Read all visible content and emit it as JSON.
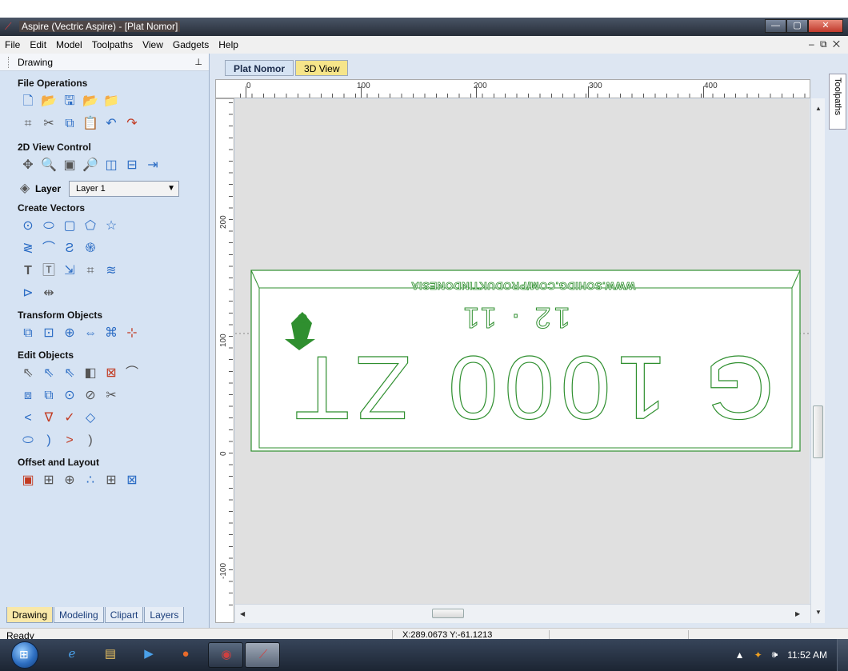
{
  "window": {
    "title": "Aspire (Vectric Aspire) - [Plat Nomor]",
    "minimize": "—",
    "restore": "▢",
    "close": "✕"
  },
  "menu": {
    "items": [
      "File",
      "Edit",
      "Model",
      "Toolpaths",
      "View",
      "Gadgets",
      "Help"
    ],
    "mdi_controls": "– ⧉ ✕"
  },
  "panel": {
    "title": "Drawing",
    "pin": "⊥",
    "sections": {
      "file_operations": "File Operations",
      "view_control": "2D View Control",
      "create_vectors": "Create Vectors",
      "transform_objects": "Transform Objects",
      "edit_objects": "Edit Objects",
      "offset_layout": "Offset and Layout"
    },
    "layer_label": "Layer",
    "layer_value": "Layer 1",
    "bottom_tabs": [
      "Drawing",
      "Modeling",
      "Clipart",
      "Layers"
    ]
  },
  "document": {
    "tabs": [
      "Plat Nomor",
      "3D View"
    ],
    "ruler_top": [
      "0",
      "100",
      "200",
      "300",
      "400"
    ],
    "ruler_left": [
      "200",
      "100",
      "0",
      "-100"
    ],
    "plate": {
      "top_text": "WWW.SOHIDG.COM/PRODUKTINDONESIA",
      "date_text": "12 · 11",
      "number_text": "G 1000 ZT"
    }
  },
  "toolpaths_tab": "Toolpaths",
  "status": {
    "ready": "Ready",
    "coords": "X:289.0673 Y:-61.1213"
  },
  "taskbar": {
    "time": "11:52 AM"
  },
  "colors": {
    "vector_green": "#2f8f2f",
    "panel_bg": "#d6e3f3",
    "active_tab": "#f9e8a8"
  }
}
